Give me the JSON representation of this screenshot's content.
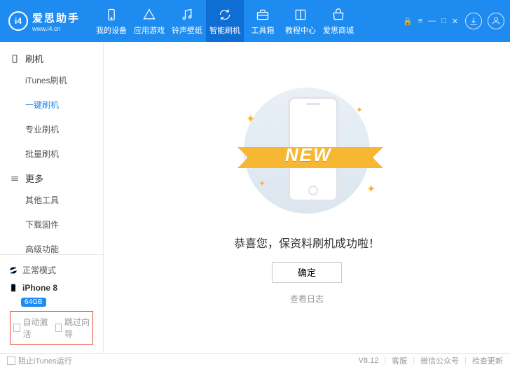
{
  "brand": {
    "name": "爱思助手",
    "url": "www.i4.cn",
    "logo": "i4"
  },
  "nav": [
    {
      "label": "我的设备",
      "icon": "phone"
    },
    {
      "label": "应用游戏",
      "icon": "apps"
    },
    {
      "label": "铃声壁纸",
      "icon": "note"
    },
    {
      "label": "智能刷机",
      "icon": "refresh",
      "active": true
    },
    {
      "label": "工具箱",
      "icon": "toolbox"
    },
    {
      "label": "教程中心",
      "icon": "book"
    },
    {
      "label": "爱思商城",
      "icon": "shop"
    }
  ],
  "sidebar": {
    "groups": [
      {
        "title": "刷机",
        "items": [
          "iTunes刷机",
          "一键刷机",
          "专业刷机",
          "批量刷机"
        ],
        "activeIndex": 1
      },
      {
        "title": "更多",
        "items": [
          "其他工具",
          "下载固件",
          "高级功能"
        ]
      }
    ],
    "mode": "正常模式",
    "device": "iPhone 8",
    "storage": "64GB",
    "checks": {
      "autoActivate": "自动激活",
      "skipGuide": "跳过向导"
    }
  },
  "main": {
    "ribbon": "NEW",
    "success": "恭喜您，保资料刷机成功啦！",
    "ok": "确定",
    "viewLog": "查看日志"
  },
  "footer": {
    "blockItunes": "阻止iTunes运行",
    "version": "V8.12",
    "links": [
      "客服",
      "微信公众号",
      "检查更新"
    ]
  }
}
